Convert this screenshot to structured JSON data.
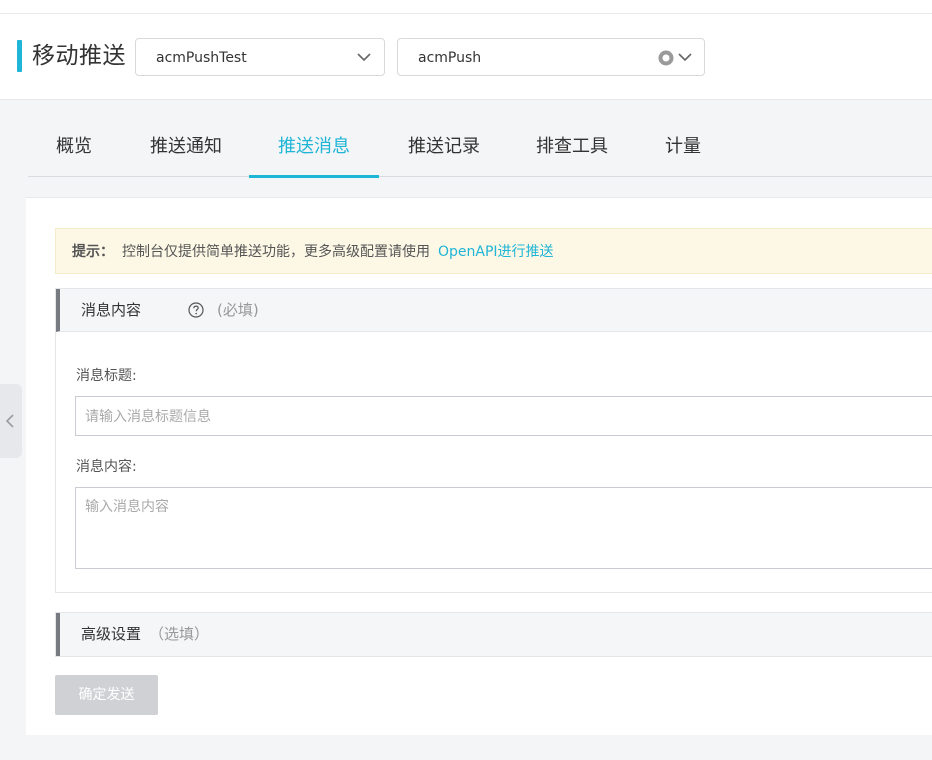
{
  "header": {
    "title": "移动推送",
    "app_select": {
      "value": "acmPushTest"
    },
    "platform_select": {
      "value": "acmPush"
    }
  },
  "tabs": [
    {
      "label": "概览"
    },
    {
      "label": "推送通知"
    },
    {
      "label": "推送消息"
    },
    {
      "label": "推送记录"
    },
    {
      "label": "排查工具"
    },
    {
      "label": "计量"
    }
  ],
  "notice": {
    "label": "提示：",
    "text": "控制台仅提供简单推送功能，更多高级配置请使用",
    "link": "OpenAPI进行推送"
  },
  "message_section": {
    "title": "消息内容",
    "required_hint": "(必填)",
    "title_label": "消息标题:",
    "title_placeholder": "请输入消息标题信息",
    "content_label": "消息内容:",
    "content_placeholder": "输入消息内容"
  },
  "advanced_section": {
    "title": "高级设置",
    "optional_hint": "（选填）"
  },
  "submit_label": "确定发送",
  "colors": {
    "accent": "#1fb5d6",
    "notice_bg": "#fdf8e6",
    "disabled_button": "#cfd1d4"
  }
}
